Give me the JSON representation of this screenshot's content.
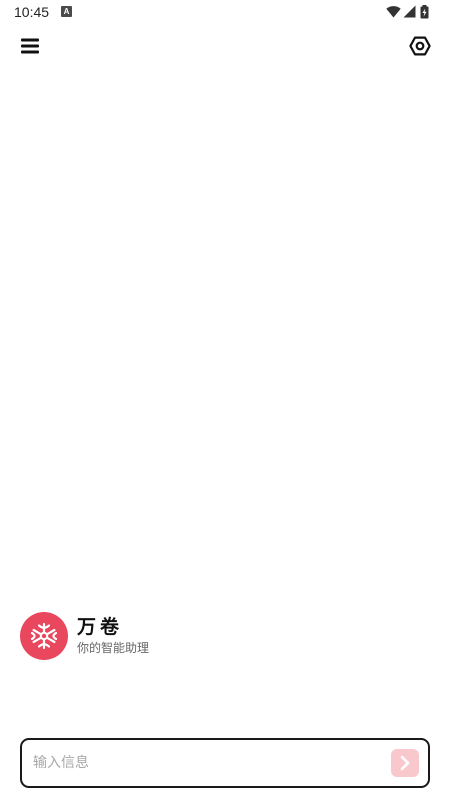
{
  "status_bar": {
    "time": "10:45",
    "notification_glyph": "A",
    "icons": [
      "wifi-icon",
      "cell-signal-icon",
      "battery-charging-icon"
    ]
  },
  "app_bar": {
    "menu_icon": "hamburger-menu-icon",
    "settings_icon": "hexagon-settings-icon"
  },
  "assistant": {
    "name": "万卷",
    "subtitle": "你的智能助理",
    "avatar_icon": "flower-logo-icon",
    "accent_color": "#e8475e"
  },
  "composer": {
    "placeholder": "输入信息",
    "value": "",
    "send_icon": "chevron-right-icon",
    "send_button_color": "#f9c8cd"
  }
}
